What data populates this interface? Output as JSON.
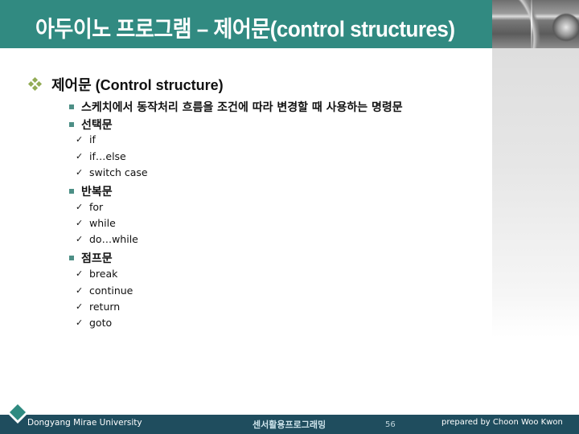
{
  "slide": {
    "title": "아두이노 프로그램 – 제어문(control structures)",
    "colors": {
      "title_bar": "#318a81",
      "footer_bar": "#1f4d5e",
      "diamond_bullet": "#92ab54",
      "square_bullet": "#4d8f86"
    }
  },
  "content": {
    "heading": {
      "bullet_icon": "four-diamond-bullet",
      "text": "제어문 (Control structure)"
    },
    "items": [
      {
        "text": "스케치에서 동작처리 흐름을 조건에 따라 변경할 때 사용하는 명령문",
        "bold": false,
        "children": []
      },
      {
        "text": "선택문",
        "bold": true,
        "children": [
          "if",
          "if…else",
          "switch case"
        ]
      },
      {
        "text": "반복문",
        "bold": true,
        "children": [
          "for",
          "while",
          "do…while"
        ]
      },
      {
        "text": "점프문",
        "bold": true,
        "children": [
          "break",
          "continue",
          "return",
          "goto"
        ]
      }
    ],
    "check_icon": "✓"
  },
  "footer": {
    "university": "Dongyang Mirae University",
    "course": "센서활용프로그래밍",
    "page_number": "56",
    "author": "prepared by Choon Woo Kwon"
  }
}
